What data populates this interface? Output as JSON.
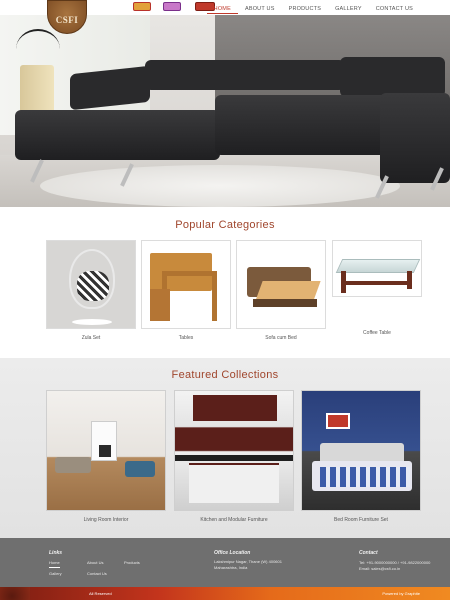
{
  "header": {
    "logo_text": "CSFI",
    "nav": [
      {
        "label": "HOME",
        "active": true
      },
      {
        "label": "ABOUT US",
        "active": false
      },
      {
        "label": "PRODUCTS",
        "active": false
      },
      {
        "label": "GALLERY",
        "active": false
      },
      {
        "label": "CONTACT US",
        "active": false
      }
    ]
  },
  "categories": {
    "title": "Popular Categories",
    "items": [
      {
        "label": "Zula Set"
      },
      {
        "label": "Tables"
      },
      {
        "label": "Sofa cum Bed"
      },
      {
        "label": "Coffee Table"
      }
    ]
  },
  "featured": {
    "title": "Featured Collections",
    "items": [
      {
        "label": "Living Room Interior"
      },
      {
        "label": "Kitchen and Modular Furniture"
      },
      {
        "label": "Bed Room Furniture Set"
      }
    ]
  },
  "footer": {
    "links_heading": "Links",
    "links": [
      "Home",
      "About Us",
      "Products",
      "Gallery",
      "Contact Us"
    ],
    "office_heading": "Office Location",
    "office_lines": [
      "Lakshmipur Nagar, Thane (W) 400601",
      "Maharashtra, India"
    ],
    "contact_heading": "Contact",
    "contact_tel": "Tel: +91-9000000000 / +91-9822000000",
    "contact_email": "Email: sales@csfi.co.in",
    "copyright": "All Reserved",
    "powered": "Powered by Graphite"
  },
  "colors": {
    "accent": "#c0392b",
    "title": "#a0462d",
    "footer_bg": "#6f6f6f"
  }
}
